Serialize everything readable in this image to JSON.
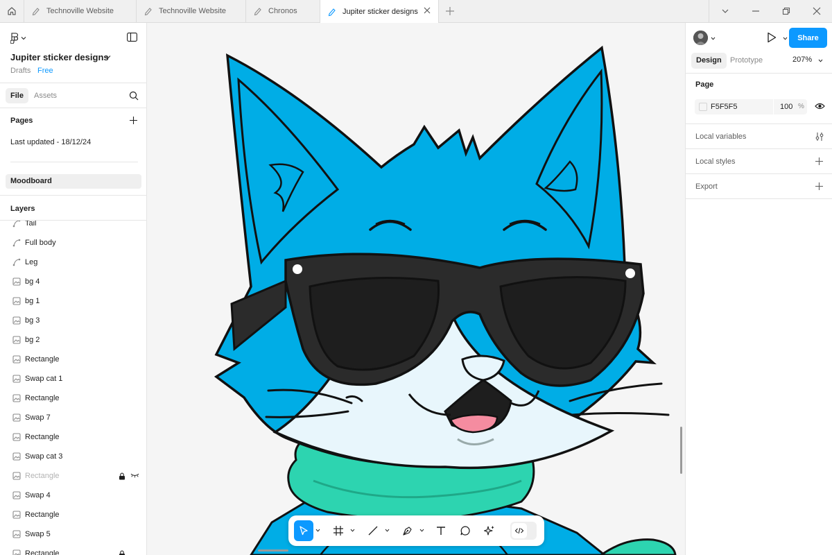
{
  "tabs": [
    {
      "label": "Technoville Website",
      "icon": "draft-file-icon"
    },
    {
      "label": "Technoville Website",
      "icon": "draft-file-icon"
    },
    {
      "label": "Chronos",
      "icon": "draft-file-icon"
    },
    {
      "label": "Jupiter sticker designs",
      "icon": "draft-file-icon",
      "active": true
    }
  ],
  "file": {
    "title": "Jupiter sticker designs",
    "location": "Drafts",
    "plan": "Free"
  },
  "left_tabs": {
    "file": "File",
    "assets": "Assets"
  },
  "pages": {
    "heading": "Pages",
    "items": [
      "Last updated - 18/12/24",
      "Moodboard"
    ]
  },
  "layers": {
    "heading": "Layers",
    "items": [
      {
        "name": "Tail",
        "icon": "vector-icon"
      },
      {
        "name": "Full body",
        "icon": "vector-icon"
      },
      {
        "name": "Leg",
        "icon": "vector-icon"
      },
      {
        "name": "bg 4",
        "icon": "image-icon"
      },
      {
        "name": "bg 1",
        "icon": "image-icon"
      },
      {
        "name": "bg 3",
        "icon": "image-icon"
      },
      {
        "name": "bg 2",
        "icon": "image-icon"
      },
      {
        "name": "Rectangle",
        "icon": "image-icon"
      },
      {
        "name": "Swap cat 1",
        "icon": "image-icon"
      },
      {
        "name": "Rectangle",
        "icon": "image-icon"
      },
      {
        "name": "Swap 7",
        "icon": "image-icon"
      },
      {
        "name": "Rectangle",
        "icon": "image-icon"
      },
      {
        "name": "Swap cat 3",
        "icon": "image-icon"
      },
      {
        "name": "Rectangle",
        "icon": "image-icon",
        "locked": true,
        "hidden": true
      },
      {
        "name": "Swap 4",
        "icon": "image-icon"
      },
      {
        "name": "Rectangle",
        "icon": "image-icon"
      },
      {
        "name": "Swap 5",
        "icon": "image-icon"
      },
      {
        "name": "Rectangle",
        "icon": "image-icon",
        "locked": true
      }
    ]
  },
  "right": {
    "share_label": "Share",
    "tabs": {
      "design": "Design",
      "prototype": "Prototype"
    },
    "zoom": "207%",
    "page_heading": "Page",
    "background_hex": "F5F5F5",
    "background_opacity": "100",
    "opacity_unit": "%",
    "sections": [
      "Local variables",
      "Local styles",
      "Export"
    ]
  },
  "help_label": "?",
  "colors": {
    "accent": "#0d99ff",
    "canvas_bg": "#f5f5f5",
    "cat_blue": "#00ade6",
    "scarf_teal": "#2dd4b0",
    "lens_dark": "#1e1e1e"
  }
}
